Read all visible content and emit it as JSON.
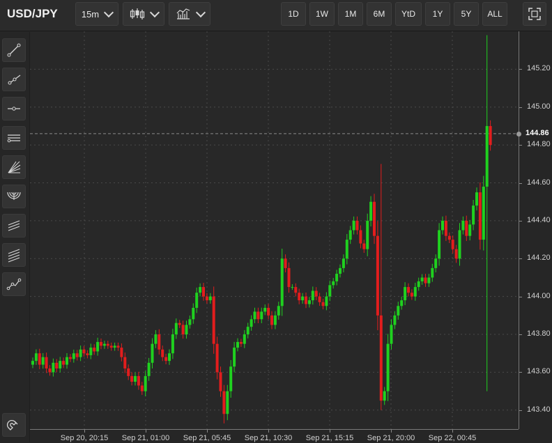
{
  "toolbar": {
    "symbol": "USD/JPY",
    "interval": "15m",
    "chart_type_icon": "candlestick-icon",
    "studies_icon": "indicators-icon",
    "ranges": [
      "1D",
      "1W",
      "1M",
      "6M",
      "YtD",
      "1Y",
      "5Y",
      "ALL"
    ],
    "fullscreen_icon": "fullscreen-icon"
  },
  "sidebar": {
    "tools": [
      {
        "name": "trend-line-tool",
        "icon": "trend-line-icon"
      },
      {
        "name": "ray-tool",
        "icon": "ray-icon"
      },
      {
        "name": "horizontal-line-tool",
        "icon": "horizontal-line-icon"
      },
      {
        "name": "horizontal-lines-tool",
        "icon": "horizontal-lines-icon"
      },
      {
        "name": "fan-tool",
        "icon": "fan-icon"
      },
      {
        "name": "arc-tool",
        "icon": "arc-icon"
      },
      {
        "name": "parallel-channel-tool",
        "icon": "parallel-channel-icon"
      },
      {
        "name": "pitchfork-tool",
        "icon": "pitchfork-icon"
      },
      {
        "name": "polyline-tool",
        "icon": "polyline-icon"
      }
    ],
    "magnet_icon": "magnet-icon"
  },
  "colors": {
    "up": "#1fd11f",
    "down": "#e21d1d",
    "background": "#282828",
    "grid": "#4a4a4a"
  },
  "chart_data": {
    "type": "candlestick",
    "ylim": [
      143.3,
      145.4
    ],
    "y_ticks": [
      "145.20",
      "145.00",
      "144.80",
      "144.60",
      "144.40",
      "144.20",
      "144.00",
      "143.80",
      "143.60",
      "143.40"
    ],
    "x_ticks": [
      "Sep 20, 20:15",
      "Sep 21, 01:00",
      "Sep 21, 05:45",
      "Sep 21, 10:30",
      "Sep 21, 15:15",
      "Sep 21, 20:00",
      "Sep 22, 00:45"
    ],
    "current_price": "144.86",
    "grid": true,
    "closes": [
      143.66,
      143.7,
      143.64,
      143.68,
      143.62,
      143.6,
      143.65,
      143.62,
      143.66,
      143.64,
      143.68,
      143.67,
      143.7,
      143.68,
      143.72,
      143.7,
      143.69,
      143.73,
      143.71,
      143.76,
      143.74,
      143.75,
      143.74,
      143.73,
      143.74,
      143.73,
      143.68,
      143.62,
      143.58,
      143.55,
      143.58,
      143.53,
      143.5,
      143.58,
      143.65,
      143.75,
      143.8,
      143.72,
      143.68,
      143.66,
      143.7,
      143.8,
      143.86,
      143.85,
      143.8,
      143.85,
      143.88,
      143.94,
      144.02,
      144.05,
      144.0,
      143.98,
      144.0,
      143.75,
      143.6,
      143.5,
      143.38,
      143.5,
      143.63,
      143.73,
      143.76,
      143.75,
      143.8,
      143.84,
      143.88,
      143.92,
      143.88,
      143.92,
      143.94,
      143.9,
      143.85,
      143.9,
      143.95,
      144.2,
      144.15,
      144.05,
      144.05,
      144.02,
      143.98,
      144.0,
      143.96,
      143.98,
      144.03,
      144.0,
      143.97,
      143.95,
      144.0,
      144.06,
      144.08,
      144.12,
      144.15,
      144.2,
      144.3,
      144.35,
      144.4,
      144.35,
      144.28,
      144.25,
      144.4,
      144.5,
      144.32,
      143.9,
      143.45,
      143.5,
      143.75,
      143.85,
      143.9,
      143.95,
      143.98,
      144.05,
      144.02,
      144.0,
      144.05,
      144.08,
      144.1,
      144.07,
      144.1,
      144.15,
      144.2,
      144.35,
      144.4,
      144.32,
      144.3,
      144.25,
      144.2,
      144.35,
      144.4,
      144.32,
      144.38,
      144.48,
      144.55,
      144.3,
      144.58,
      144.9,
      144.8
    ]
  }
}
